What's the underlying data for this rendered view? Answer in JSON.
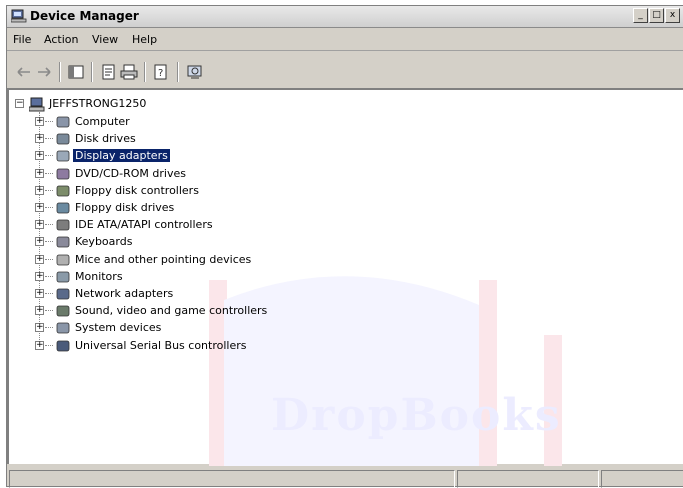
{
  "window": {
    "title": "Device Manager"
  },
  "title_buttons": {
    "minimize": "_",
    "maximize": "□",
    "close": "x"
  },
  "menubar": {
    "items": [
      "File",
      "Action",
      "View",
      "Help"
    ]
  },
  "toolbar": {
    "icons": [
      "back-arrow-icon",
      "forward-arrow-icon",
      "show-hide-tree-icon",
      "properties-icon",
      "print-icon",
      "help-icon",
      "scan-hardware-icon"
    ]
  },
  "tree": {
    "root": "JEFFSTRONG1250",
    "items": [
      {
        "label": "Computer",
        "icon": "computer-icon"
      },
      {
        "label": "Disk drives",
        "icon": "disk-drive-icon"
      },
      {
        "label": "Display adapters",
        "icon": "display-adapter-icon",
        "selected": true
      },
      {
        "label": "DVD/CD-ROM drives",
        "icon": "cdrom-icon"
      },
      {
        "label": "Floppy disk controllers",
        "icon": "floppy-controller-icon"
      },
      {
        "label": "Floppy disk drives",
        "icon": "floppy-drive-icon"
      },
      {
        "label": "IDE ATA/ATAPI controllers",
        "icon": "ide-controller-icon"
      },
      {
        "label": "Keyboards",
        "icon": "keyboard-icon"
      },
      {
        "label": "Mice and other pointing devices",
        "icon": "mouse-icon"
      },
      {
        "label": "Monitors",
        "icon": "monitor-icon"
      },
      {
        "label": "Network adapters",
        "icon": "network-adapter-icon"
      },
      {
        "label": "Sound, video and game controllers",
        "icon": "sound-icon"
      },
      {
        "label": "System devices",
        "icon": "system-devices-icon"
      },
      {
        "label": "Universal Serial Bus controllers",
        "icon": "usb-icon"
      }
    ],
    "expander_symbol": "+",
    "root_expander_symbol": "−"
  },
  "watermark": {
    "text": "DropBooks"
  },
  "colors": {
    "selection": "#0a246a",
    "window_face": "#d4d0c8"
  }
}
